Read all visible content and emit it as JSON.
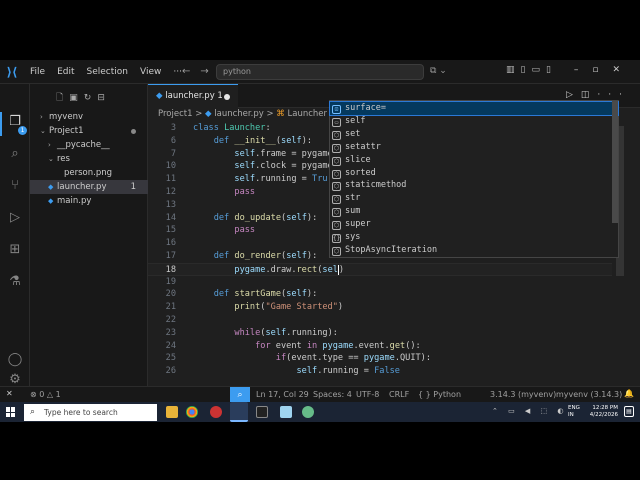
{
  "titlebar": {
    "menu": [
      "File",
      "Edit",
      "Selection",
      "View"
    ],
    "search_text": "python"
  },
  "sidebar": {
    "items": [
      {
        "label": "myvenv",
        "chev": "›"
      },
      {
        "label": "Project1",
        "chev": "⌄"
      },
      {
        "label": "__pycache__",
        "chev": "›"
      },
      {
        "label": "res",
        "chev": "⌄"
      },
      {
        "label": "person.png"
      },
      {
        "label": "launcher.py",
        "count": "1"
      },
      {
        "label": "main.py"
      }
    ]
  },
  "tab": {
    "label": "launcher.py 1"
  },
  "breadcrumb": {
    "parts": [
      "Project1",
      "launcher.py",
      "Launcher"
    ],
    "separator": ">"
  },
  "editor": {
    "line_numbers": [
      "3",
      "6",
      "7",
      "10",
      "11",
      "12",
      "13",
      "14",
      "15",
      "16",
      "17",
      "18",
      "19",
      "20",
      "21",
      "22",
      "23",
      "24",
      "25",
      "26"
    ],
    "current_line": "17"
  },
  "suggest": {
    "items": [
      {
        "label": "surface=",
        "kind": "var"
      },
      {
        "label": "self",
        "kind": "kw"
      },
      {
        "label": "set",
        "kind": "cls"
      },
      {
        "label": "setattr",
        "kind": "fn"
      },
      {
        "label": "slice",
        "kind": "cls"
      },
      {
        "label": "sorted",
        "kind": "fn"
      },
      {
        "label": "staticmethod",
        "kind": "cls"
      },
      {
        "label": "str",
        "kind": "cls"
      },
      {
        "label": "sum",
        "kind": "fn"
      },
      {
        "label": "super",
        "kind": "cls"
      },
      {
        "label": "sys",
        "kind": "mod"
      },
      {
        "label": "StopAsyncIteration",
        "kind": "cls"
      }
    ]
  },
  "statusbar": {
    "errors": "0",
    "warnings": "1",
    "position": "Ln 17, Col 29",
    "spaces": "Spaces: 4",
    "encoding": "UTF-8",
    "eol": "CRLF",
    "language": "Python",
    "interpreter": "3.14.3 (myvenv)",
    "env": "myvenv (3.14.3)"
  },
  "taskbar": {
    "search_placeholder": "Type here to search",
    "lang_1": "ENG",
    "lang_2": "IN",
    "time": "12:28 PM",
    "date": "4/22/2026"
  },
  "colors": {
    "accent": "#3c9cf0",
    "editor_bg": "#1f1f1f",
    "keyword": "#569cd6",
    "function": "#dcdcaa",
    "string": "#ce9178"
  }
}
